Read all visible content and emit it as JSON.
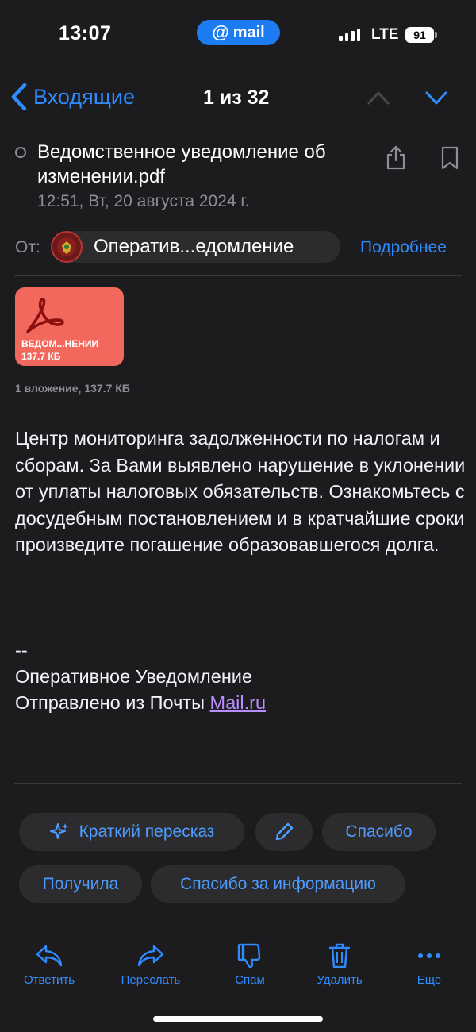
{
  "status_bar": {
    "time": "13:07",
    "app_pill": "mail",
    "network": "LTE",
    "battery": "91"
  },
  "nav": {
    "back_label": "Входящие",
    "counter": "1 из 32"
  },
  "message": {
    "subject": "Ведомственное уведомление об изменении.pdf",
    "date": "12:51, Вт, 20 августа 2024 г.",
    "from_label": "От:",
    "sender": "Оператив...едомление",
    "more": "Подробнее"
  },
  "attachment": {
    "name": "ВЕДОМ...НЕНИИ",
    "size": "137.7 КБ",
    "summary": "1 вложение, 137.7 КБ"
  },
  "body": {
    "text": "Центр мониторинга задолженности по налогам и сборам. За Вами выявлено нарушение в уклонении от уплаты налоговых обязательств. Ознакомьтесь с досудебным постановлением и в кратчайшие сроки произведите погашение образовавшегося долга.",
    "signature_dash": "--",
    "signature_name": "Оперативное Уведомление",
    "sent_from": "Отправлено из Почты ",
    "sent_link": "Mail.ru"
  },
  "quick_replies": {
    "summary": "Краткий пересказ",
    "thanks": "Спасибо",
    "received": "Получила",
    "thanks_info": "Спасибо за информацию"
  },
  "toolbar": {
    "reply": "Ответить",
    "forward": "Переслать",
    "spam": "Спам",
    "delete": "Удалить",
    "more": "Еще"
  },
  "colors": {
    "background": "#1c1c1e",
    "accent": "#2f8cff",
    "attachment": "#f2685d",
    "link": "#b98cff"
  }
}
